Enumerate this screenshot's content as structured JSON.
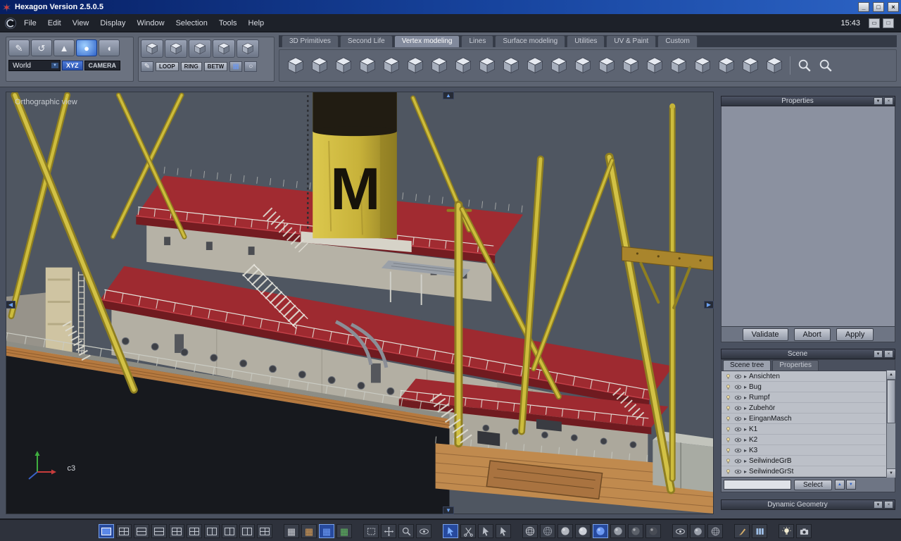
{
  "window": {
    "title": "Hexagon Version 2.5.0.5",
    "minimize_glyph": "_",
    "maximize_glyph": "□",
    "close_glyph": "×"
  },
  "menubar": {
    "items": [
      "File",
      "Edit",
      "View",
      "Display",
      "Window",
      "Selection",
      "Tools",
      "Help"
    ],
    "clock": "15:43",
    "window_buttons": [
      {
        "name": "workspace-minimize-button",
        "glyph": "▭"
      },
      {
        "name": "workspace-maximize-button",
        "glyph": "□"
      }
    ]
  },
  "ribbon_tabs": [
    {
      "label": "3D Primitives"
    },
    {
      "label": "Second Life"
    },
    {
      "label": "Vertex modeling",
      "active": true
    },
    {
      "label": "Lines"
    },
    {
      "label": "Surface modeling"
    },
    {
      "label": "Utilities"
    },
    {
      "label": "UV & Paint"
    },
    {
      "label": "Custom"
    }
  ],
  "left_palette": {
    "tools": [
      {
        "name": "knife-tool-icon",
        "glyph": "✎"
      },
      {
        "name": "rotate-view-tool-icon",
        "glyph": "↺"
      },
      {
        "name": "cone-primitive-icon",
        "glyph": "▲"
      },
      {
        "name": "sphere-primitive-icon",
        "glyph": "●",
        "active": true
      },
      {
        "name": "capsule-primitive-icon",
        "glyph": "◖"
      }
    ],
    "world_dropdown": "World",
    "dropdown_arrow": "▼",
    "xyz_button": "XYZ",
    "camera_button": "CAMERA"
  },
  "edit_palette": {
    "cubes": [
      {
        "name": "select-cube-icon"
      },
      {
        "name": "translate-cube-icon"
      },
      {
        "name": "rotate-cube-icon"
      },
      {
        "name": "scale-cube-icon"
      },
      {
        "name": "snap-cube-icon"
      }
    ],
    "pencil_glyph": "✎",
    "loop_button": "LOOP",
    "ring_button": "RING",
    "betw_button": "BETW",
    "tail_tools": [
      {
        "name": "grid-select-icon",
        "glyph": "▦",
        "color": "#6b98f2"
      },
      {
        "name": "circle-select-icon",
        "glyph": "○"
      }
    ]
  },
  "main_toolbar": {
    "icons": [
      {
        "name": "stretch-tool-icon"
      },
      {
        "name": "smooth-tool-icon"
      },
      {
        "name": "thickness-tool-icon"
      },
      {
        "name": "extract-faces-tool-icon"
      },
      {
        "name": "average-vertices-tool-icon"
      },
      {
        "name": "extrude-surface-tool-icon"
      },
      {
        "name": "sweep-surface-tool-icon"
      },
      {
        "name": "doo-sabin-smooth-tool-icon"
      },
      {
        "name": "dissolve-tool-icon"
      },
      {
        "name": "decimate-tool-icon"
      },
      {
        "name": "triangulate-tool-icon"
      },
      {
        "name": "quadrangulate-tool-icon"
      },
      {
        "name": "weld-points-tool-icon"
      },
      {
        "name": "target-weld-tool-icon"
      },
      {
        "name": "bridge-tool-icon"
      },
      {
        "name": "close-surface-tool-icon"
      },
      {
        "name": "symmetry-tool-icon"
      },
      {
        "name": "copy-tool-icon"
      },
      {
        "name": "bend-tool-icon"
      },
      {
        "name": "offset-tool-icon"
      },
      {
        "name": "inset-tool-icon"
      }
    ],
    "zoom_tools": [
      {
        "name": "magnifier-plus-icon",
        "symbol": "magnifier"
      },
      {
        "name": "magnifier-focus-icon",
        "symbol": "magnifier"
      }
    ]
  },
  "viewport": {
    "label": "Orthographic view",
    "axis_label": "c3",
    "funnel_letter": "M",
    "pan_up": "▲",
    "pan_down": "▼",
    "pan_left": "◀",
    "pan_right": "▶"
  },
  "properties_panel": {
    "title": "Properties",
    "collapse_glyph": "▼",
    "close_glyph": "×",
    "validate": "Validate",
    "abort": "Abort",
    "apply": "Apply"
  },
  "scene_panel": {
    "title": "Scene",
    "collapse_glyph": "▼",
    "close_glyph": "×",
    "tabs": [
      {
        "label": "Scene tree",
        "active": true
      },
      {
        "label": "Properties"
      }
    ],
    "items": [
      "Ansichten",
      "Bug",
      "Rumpf",
      "Zubehör",
      "EinganMasch",
      "K1",
      "K2",
      "K3",
      "SeilwindeGrB",
      "SeilwindeGrSt"
    ],
    "scroll_up": "▲",
    "scroll_down": "▼",
    "select_button": "Select",
    "spin_buttons": [
      {
        "name": "scene-spin-up-button",
        "glyph": "▲"
      },
      {
        "name": "scene-spin-down-button",
        "glyph": "▼"
      }
    ]
  },
  "dynamic_geometry": {
    "title": "Dynamic Geometry",
    "collapse_glyph": "▼",
    "close_glyph": "×"
  },
  "bottom_toolbar": {
    "layout_icons": [
      {
        "name": "layout-single-view-icon",
        "variant": "single",
        "active": true
      },
      {
        "name": "layout-quad-view-icon",
        "variant": "quad"
      },
      {
        "name": "layout-two-rows-icon",
        "variant": "hsplit"
      },
      {
        "name": "layout-row-top-icon",
        "variant": "hsplit"
      },
      {
        "name": "layout-three-bottom-icon",
        "variant": "quad"
      },
      {
        "name": "layout-three-top-icon",
        "variant": "quad"
      },
      {
        "name": "layout-two-columns-icon",
        "variant": "vsplit"
      },
      {
        "name": "layout-column-left-icon",
        "variant": "vsplit"
      },
      {
        "name": "layout-column-right-icon",
        "variant": "vsplit"
      },
      {
        "name": "layout-custom-split-icon",
        "variant": "quad"
      }
    ],
    "grid_icons": [
      {
        "name": "uv-grid-icon",
        "glyph": "▦",
        "color": "#c9ccd2"
      },
      {
        "name": "texture-grid-icon",
        "glyph": "▦",
        "color": "#d59a54"
      },
      {
        "name": "snap-grid-icon",
        "glyph": "▦",
        "color": "#6b98f2",
        "active": true
      },
      {
        "name": "material-grid-icon",
        "glyph": "▦",
        "color": "#5cb45e"
      }
    ],
    "nav_icons": [
      {
        "name": "frame-all-icon",
        "symbol": "frame"
      },
      {
        "name": "pan-view-icon",
        "symbol": "move"
      },
      {
        "name": "zoom-view-icon",
        "symbol": "magnifier"
      },
      {
        "name": "examine-view-icon",
        "symbol": "eye"
      }
    ],
    "select_icons": [
      {
        "name": "select-cursor-icon",
        "symbol": "arrowcursor",
        "color": "#7db0ff",
        "active": true
      },
      {
        "name": "cut-selection-icon",
        "symbol": "scissors"
      },
      {
        "name": "grow-selection-icon",
        "symbol": "arrowcursor"
      },
      {
        "name": "select-through-icon",
        "symbol": "arrowcursor"
      }
    ],
    "shading_icons": [
      {
        "name": "wireframe-shading-icon",
        "symbol": "wiresphere",
        "color": "#c8ccd4"
      },
      {
        "name": "hidden-line-shading-icon",
        "symbol": "wiresphere",
        "color": "#8f95a0"
      },
      {
        "name": "flat-shading-icon",
        "symbol": "sphere",
        "color": "#b4b8c0"
      },
      {
        "name": "smooth-shading-icon",
        "symbol": "sphere",
        "color": "#ccd0d8"
      },
      {
        "name": "textured-shading-icon",
        "symbol": "sphere",
        "color": "#6b98f2",
        "active": true
      },
      {
        "name": "material-shading-icon",
        "symbol": "sphere",
        "color": "#989ea8"
      },
      {
        "name": "dark-shading-icon",
        "symbol": "sphere",
        "color": "#5c616a"
      },
      {
        "name": "points-shading-icon",
        "symbol": "sphere",
        "color": "#484c55"
      }
    ],
    "visibility_icons": [
      {
        "name": "show-wireframe-icon",
        "symbol": "eye",
        "color": "#c2c6ce"
      },
      {
        "name": "show-shaded-icon",
        "symbol": "sphere",
        "color": "#9aa0ab"
      },
      {
        "name": "show-overlay-icon",
        "symbol": "wiresphere",
        "color": "#aeb2bb"
      }
    ],
    "paint_icons": [
      {
        "name": "paint-brush-icon",
        "symbol": "brush",
        "color": "#d8b06a"
      },
      {
        "name": "uv-columns-icon",
        "symbol": "columns",
        "color": "#9fc0e8"
      }
    ],
    "render_icons": [
      {
        "name": "ambient-light-icon",
        "symbol": "bulb",
        "color": "#f2ecd2"
      },
      {
        "name": "render-camera-icon",
        "symbol": "camera",
        "color": "#c8ccd4"
      }
    ]
  }
}
